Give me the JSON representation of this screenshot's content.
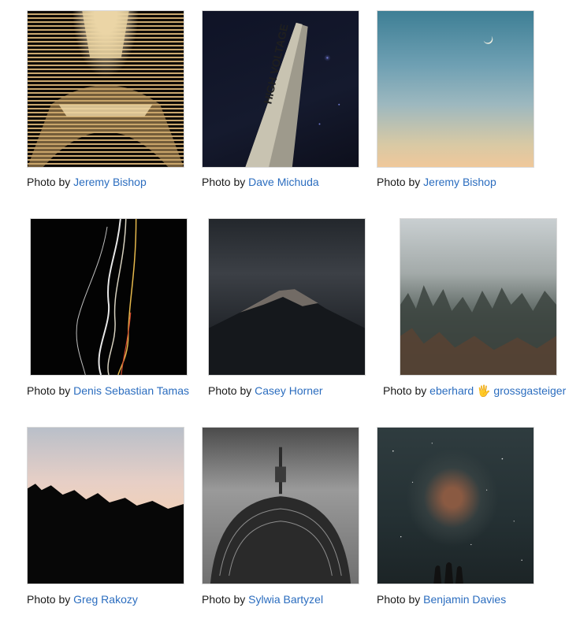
{
  "gallery": {
    "caption_prefix": "Photo by",
    "photos": [
      {
        "author": "Jeremy Bishop",
        "subject": "eiffel-tower"
      },
      {
        "author": "Dave Michuda",
        "subject": "high-voltage-pole"
      },
      {
        "author": "Jeremy Bishop",
        "subject": "sky-crescent-moon"
      },
      {
        "author": "Denis Sebastian Tamas",
        "subject": "light-trails"
      },
      {
        "author": "Casey Horner",
        "subject": "dark-mountain"
      },
      {
        "author": "eberhard 🖐 grossgasteiger",
        "subject": "foggy-forest"
      },
      {
        "author": "Greg Rakozy",
        "subject": "treeline-sunset"
      },
      {
        "author": "Sylwia Bartyzel",
        "subject": "tv-tower"
      },
      {
        "author": "Benjamin Davies",
        "subject": "milky-way"
      }
    ],
    "photo_text": {
      "voltage_sign": "HIGH VOLTAGE"
    }
  },
  "colors": {
    "link": "#2b6dbf",
    "text": "#1a1a1a",
    "border": "#d9d9d9"
  }
}
